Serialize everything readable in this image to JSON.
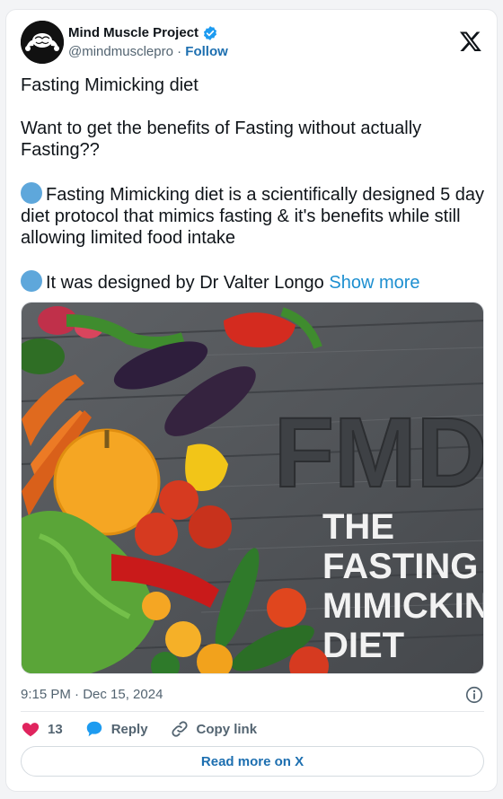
{
  "author": {
    "name": "Mind Muscle Project",
    "handle": "@mindmusclepro",
    "separator": "·",
    "follow_label": "Follow"
  },
  "post": {
    "lines": [
      "Fasting Mimicking diet",
      "Want to get the benefits of Fasting without actually Fasting??",
      "Fasting Mimicking diet is a scientifically designed 5 day diet protocol that mimics fasting & it's benefits while still allowing limited food intake",
      "It was designed by Dr Valter Longo"
    ],
    "show_more": "Show more"
  },
  "media": {
    "big_text": "FMD",
    "caption_lines": [
      "THE",
      "FASTING",
      "MIMICKING",
      "DIET"
    ]
  },
  "meta": {
    "timestamp": "9:15 PM · Dec 15, 2024"
  },
  "actions": {
    "like_count": "13",
    "reply_label": "Reply",
    "copy_label": "Copy link"
  },
  "read_more_label": "Read more on X",
  "colors": {
    "accent": "#1d6fb0",
    "link": "#1d8fd0",
    "like": "#e0245e",
    "reply": "#1d9bf0",
    "emoji_dot": "#5ea7db"
  }
}
